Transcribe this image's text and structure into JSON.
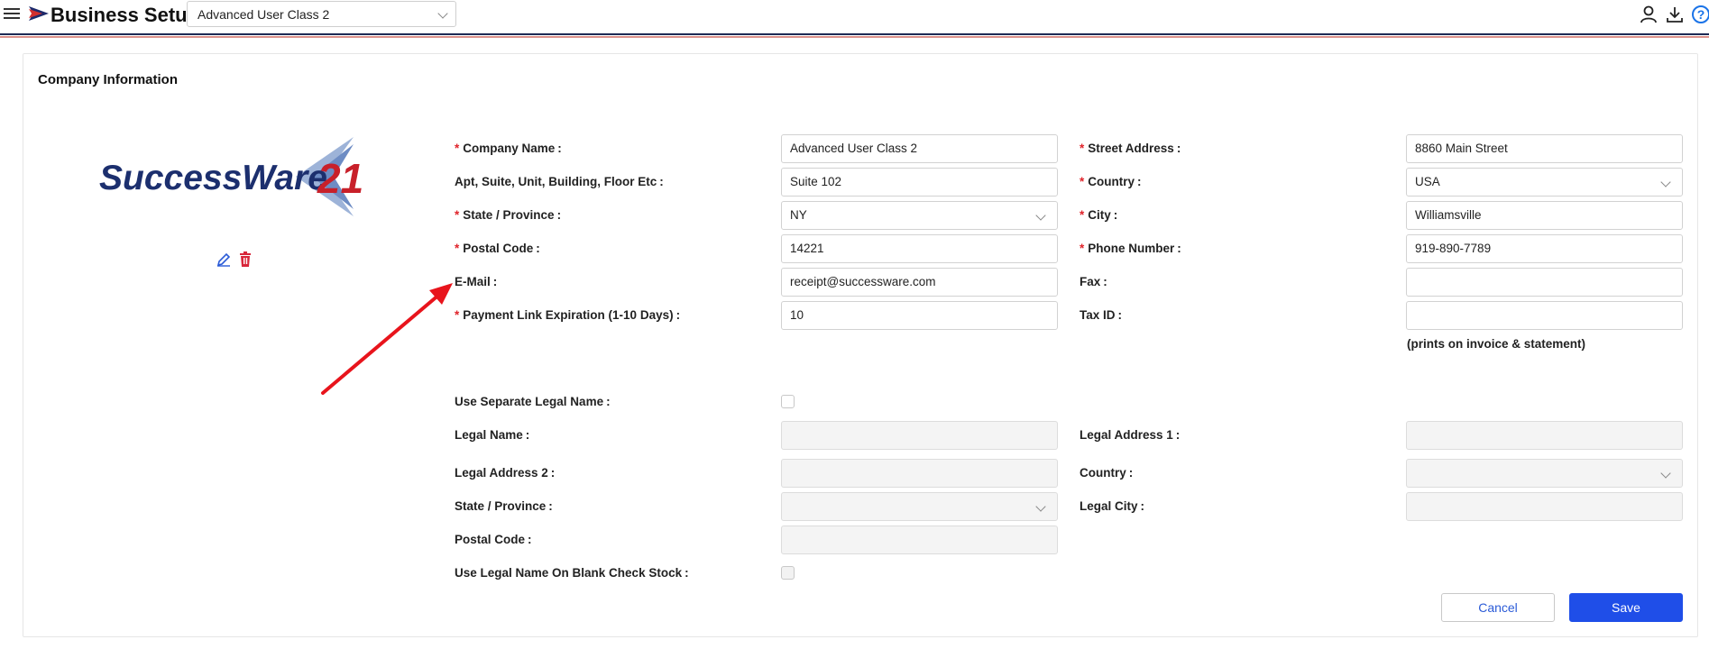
{
  "header": {
    "title": "Business Setup",
    "company_selector": "Advanced User Class 2"
  },
  "section": {
    "title": "Company Information"
  },
  "logo": {
    "text": "SuccessWare",
    "number": "21"
  },
  "form": {
    "company_name": {
      "label": "Company Name",
      "value": "Advanced User Class 2"
    },
    "street_address": {
      "label": "Street Address",
      "value": "8860 Main Street"
    },
    "apt_suite": {
      "label": "Apt, Suite, Unit, Building, Floor Etc",
      "value": "Suite 102"
    },
    "country": {
      "label": "Country",
      "value": "USA"
    },
    "state": {
      "label": "State / Province",
      "value": "NY"
    },
    "city": {
      "label": "City",
      "value": "Williamsville"
    },
    "postal_code": {
      "label": "Postal Code",
      "value": "14221"
    },
    "phone": {
      "label": "Phone Number",
      "value": "919-890-7789"
    },
    "email": {
      "label": "E-Mail",
      "value": "receipt@successware.com"
    },
    "fax": {
      "label": "Fax",
      "value": ""
    },
    "payment_link": {
      "label": "Payment Link Expiration (1-10 Days)",
      "value": "10"
    },
    "tax_id": {
      "label": "Tax ID",
      "value": ""
    },
    "tax_note": "(prints on invoice & statement)",
    "use_legal_name": {
      "label": "Use Separate Legal Name",
      "checked": false
    },
    "legal_name": {
      "label": "Legal Name",
      "value": ""
    },
    "legal_address_1": {
      "label": "Legal Address 1",
      "value": ""
    },
    "legal_address_2": {
      "label": "Legal Address 2",
      "value": ""
    },
    "legal_country": {
      "label": "Country",
      "value": ""
    },
    "legal_state": {
      "label": "State / Province",
      "value": ""
    },
    "legal_city": {
      "label": "Legal City",
      "value": ""
    },
    "legal_postal": {
      "label": "Postal Code",
      "value": ""
    },
    "legal_check_stock": {
      "label": "Use Legal Name On Blank Check Stock",
      "checked": false
    }
  },
  "buttons": {
    "cancel": "Cancel",
    "save": "Save"
  },
  "colors": {
    "primary": "#1f4ee8",
    "required": "#e0242b",
    "annotation_arrow": "#e8141c"
  }
}
